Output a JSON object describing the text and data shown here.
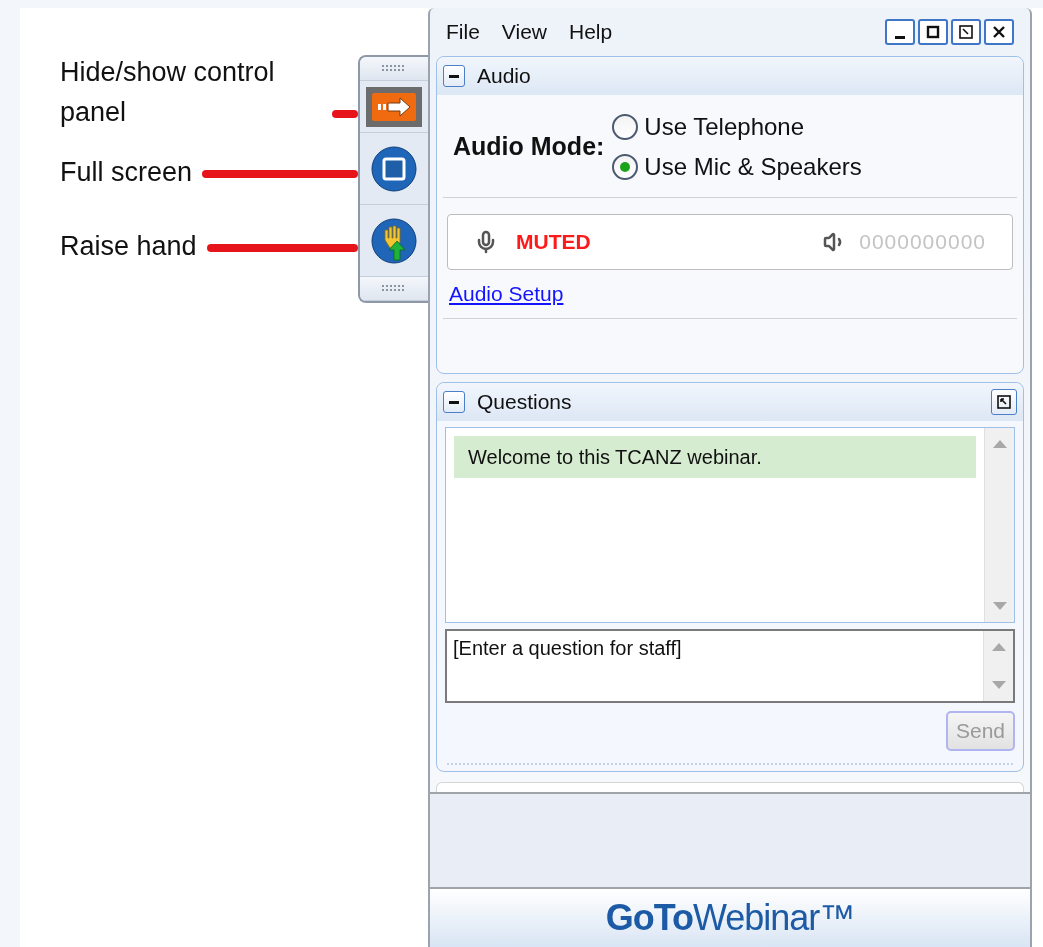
{
  "annotations": [
    {
      "label": "Hide/show control panel"
    },
    {
      "label": "Full screen"
    },
    {
      "label": "Raise hand"
    }
  ],
  "control_strip": {
    "buttons": [
      {
        "kind": "toggle-panel",
        "selected": true
      },
      {
        "kind": "fullscreen",
        "selected": false
      },
      {
        "kind": "raise-hand",
        "selected": false
      }
    ]
  },
  "menu": [
    "File",
    "View",
    "Help"
  ],
  "audio": {
    "title": "Audio",
    "expanded": true,
    "mode_label": "Audio Mode:",
    "options": [
      {
        "label": "Use Telephone",
        "selected": false
      },
      {
        "label": "Use Mic & Speakers",
        "selected": true
      }
    ],
    "mic_status": "MUTED",
    "speaker_level": "0000000000",
    "setup_link": "Audio Setup"
  },
  "questions": {
    "title": "Questions",
    "expanded": true,
    "messages": [
      "Welcome to this TCANZ webinar."
    ],
    "input": {
      "placeholder": "[Enter a question for staff]"
    },
    "send": {
      "label": "Send",
      "disabled": true
    }
  },
  "logo": "**GoTo**Webinar™"
}
